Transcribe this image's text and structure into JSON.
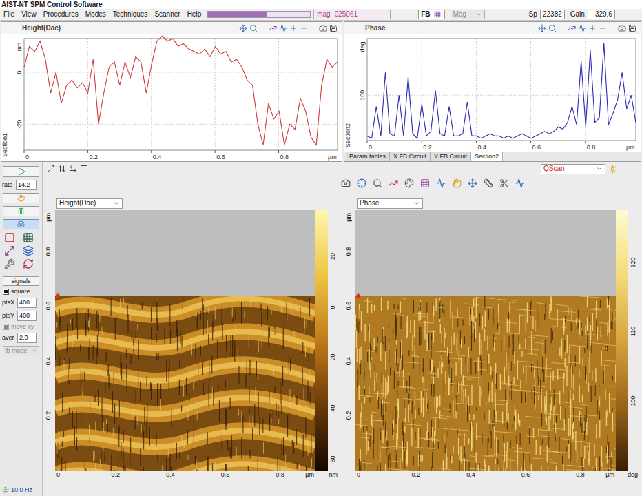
{
  "window": {
    "title": "AIST-NT SPM Control Software"
  },
  "menu": [
    "File",
    "View",
    "Procedures",
    "Modes",
    "Techniques",
    "Scanner",
    "Help"
  ],
  "toolbar": {
    "progress": {
      "level": 0.58
    },
    "mag": {
      "label": "mag",
      "value": "025061"
    },
    "fb": {
      "label": "FB"
    },
    "mode_select": {
      "value": "Mag",
      "disabled": true
    },
    "sp": {
      "label": "Sp",
      "value": "22382"
    },
    "gain": {
      "label": "Gain",
      "value": "329,6"
    }
  },
  "section_charts": [
    {
      "title": "Height(Dac)",
      "side_label": "Section1",
      "y_unit": "nm",
      "y_min": -30,
      "y_max": 13,
      "y_ticks": [
        {
          "label": "0",
          "value": 0
        },
        {
          "label": "-20",
          "value": -20
        }
      ],
      "x_min": 0,
      "x_max": 0.985,
      "x_ticks": [
        {
          "label": "0",
          "value": 0
        },
        {
          "label": "0.2",
          "value": 0.2
        },
        {
          "label": "0.4",
          "value": 0.4
        },
        {
          "label": "0.6",
          "value": 0.6
        },
        {
          "label": "0.8",
          "value": 0.8
        }
      ],
      "x_unit": "µm",
      "series": {
        "color": "#d03a3a",
        "values": [
          2,
          10,
          8,
          12,
          5,
          -8,
          0,
          -12,
          -5,
          -3,
          -6,
          -4,
          -8,
          5,
          -20,
          -8,
          2,
          4,
          -5,
          4,
          -2,
          6,
          4,
          -8,
          3,
          12,
          14,
          12,
          13,
          10,
          11,
          9,
          8,
          7,
          9,
          6,
          10,
          7,
          8,
          4,
          5,
          2,
          -3,
          -5,
          -20,
          -28,
          -12,
          -18,
          -15,
          -28,
          -20,
          -22,
          -10,
          -15,
          -25,
          -28,
          -5,
          5,
          2,
          4
        ]
      }
    },
    {
      "title": "Phase",
      "side_label": "Section2",
      "y_unit": "deg",
      "y_min": 80,
      "y_max": 125,
      "y_ticks": [
        {
          "label": "100",
          "value": 100
        }
      ],
      "x_min": 0,
      "x_max": 0.985,
      "x_ticks": [
        {
          "label": "0",
          "value": 0
        },
        {
          "label": "0.2",
          "value": 0.2
        },
        {
          "label": "0.4",
          "value": 0.4
        },
        {
          "label": "0.6",
          "value": 0.6
        },
        {
          "label": "0.8",
          "value": 0.8
        }
      ],
      "x_unit": "µm",
      "series": {
        "color": "#2a2ab0",
        "values": [
          82,
          81,
          95,
          82,
          110,
          83,
          82,
          100,
          82,
          108,
          83,
          81,
          96,
          82,
          84,
          102,
          83,
          82,
          95,
          82,
          82,
          83,
          97,
          82,
          82,
          81,
          82,
          83,
          82,
          82,
          81,
          82,
          81,
          82,
          83,
          82,
          81,
          82,
          83,
          84,
          83,
          84,
          86,
          85,
          88,
          95,
          87,
          115,
          86,
          120,
          88,
          90,
          123,
          87,
          92,
          98,
          110,
          94,
          100,
          88
        ]
      }
    }
  ],
  "section_tabs": [
    {
      "label": "Param tables",
      "selected": false
    },
    {
      "label": "X FB Circuit",
      "selected": false
    },
    {
      "label": "Y FB Circuit",
      "selected": false
    },
    {
      "label": "Section2",
      "selected": true
    }
  ],
  "control_panel": {
    "rate": {
      "label": "rate",
      "value": "14,2"
    },
    "signals_button": "signals",
    "square": {
      "label": "square",
      "checked": true,
      "disabled": false
    },
    "pts": [
      {
        "label": "ptsX",
        "value": "400"
      },
      {
        "label": "ptsY",
        "value": "400"
      }
    ],
    "move_xy": {
      "label": "move xy",
      "checked": true,
      "disabled": true
    },
    "aver": {
      "label": "aver",
      "value": "2,0"
    },
    "fb_mode": {
      "value": "fb mode",
      "disabled": true
    },
    "status": "10.0 Hz"
  },
  "scan_mode": {
    "value": "QScan"
  },
  "images": [
    {
      "channel": "Height(Dac)",
      "kind": "height",
      "scan_level": 0.67,
      "y_unit": "µm",
      "range": 0.95,
      "y_ticks": [
        {
          "label": "0.8",
          "value": 0.8
        },
        {
          "label": "0.6",
          "value": 0.6
        },
        {
          "label": "0.4",
          "value": 0.4
        },
        {
          "label": "0.2",
          "value": 0.2
        }
      ],
      "x_ticks": [
        {
          "label": "0",
          "value": 0
        },
        {
          "label": "0.2",
          "value": 0.2
        },
        {
          "label": "0.4",
          "value": 0.4
        },
        {
          "label": "0.6",
          "value": 0.6
        },
        {
          "label": "0.8",
          "value": 0.8
        }
      ],
      "x_unit": "µm",
      "colorbar": {
        "min": -64,
        "max": 38,
        "unit": "nm",
        "ticks": [
          {
            "label": "20",
            "value": 20
          },
          {
            "label": "0",
            "value": 0
          },
          {
            "label": "-20",
            "value": -20
          },
          {
            "label": "-40",
            "value": -40
          },
          {
            "label": "-60",
            "value": -60
          }
        ]
      }
    },
    {
      "channel": "Phase",
      "kind": "phase",
      "scan_level": 0.67,
      "y_unit": "µm",
      "range": 0.95,
      "y_ticks": [
        {
          "label": "0.8",
          "value": 0.8
        },
        {
          "label": "0.6",
          "value": 0.6
        },
        {
          "label": "0.4",
          "value": 0.4
        },
        {
          "label": "0.2",
          "value": 0.2
        }
      ],
      "x_ticks": [
        {
          "label": "0",
          "value": 0
        },
        {
          "label": "0.2",
          "value": 0.2
        },
        {
          "label": "0.4",
          "value": 0.4
        },
        {
          "label": "0.6",
          "value": 0.6
        },
        {
          "label": "0.8",
          "value": 0.8
        }
      ],
      "x_unit": "µm",
      "colorbar": {
        "min": 90,
        "max": 127.5,
        "unit": "deg",
        "ticks": [
          {
            "label": "120",
            "value": 120
          },
          {
            "label": "110",
            "value": 110
          },
          {
            "label": "100",
            "value": 100
          }
        ]
      }
    }
  ]
}
